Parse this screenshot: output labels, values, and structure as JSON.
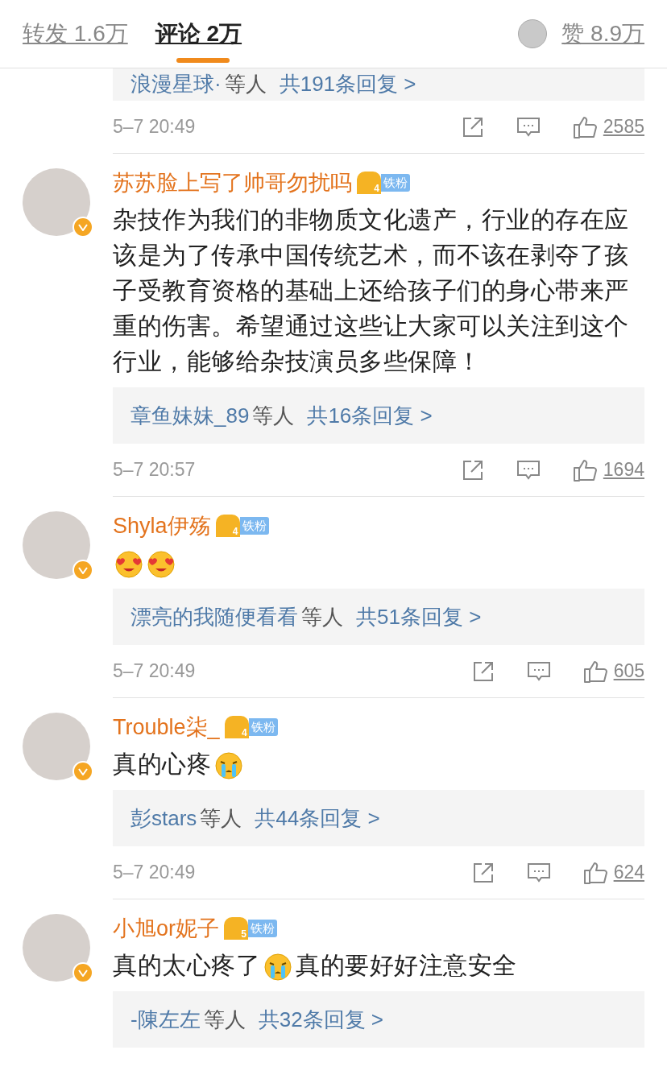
{
  "tabs": [
    {
      "label": "转发 1.6万",
      "selected": false
    },
    {
      "label": "评论 2万",
      "selected": true
    }
  ],
  "likes_tab": {
    "label": "赞 8.9万"
  },
  "partial_thread": {
    "replies": {
      "users": "浪漫星球·",
      "others": "等人",
      "count": "共191条回复 >"
    },
    "time": "5–7 20:49",
    "likes": "2585"
  },
  "comments": [
    {
      "name": "苏苏脸上写了帅哥勿扰吗",
      "verified": true,
      "badge_level": "4",
      "fan_label": "铁粉",
      "body": [
        {
          "kind": "text",
          "text": "杂技作为我们的非物质文化遗产，行业的存在应该是为了传承中国传统艺术，而不该在剥夺了孩子受教育资格的基础上还给孩子们的身心带来严重的伤害。希望通过这些让大家可以关注到这个行业，能够给杂技演员多些保障！"
        }
      ],
      "replies": {
        "users": "章鱼妹妹_89",
        "others": "等人",
        "count": "共16条回复 >"
      },
      "time": "5–7 20:57",
      "likes": "1694"
    },
    {
      "name": "Shyla伊殇",
      "verified": true,
      "badge_level": "4",
      "fan_label": "铁粉",
      "body": [
        {
          "kind": "love_emoji"
        },
        {
          "kind": "love_emoji"
        }
      ],
      "replies": {
        "users": "漂亮的我随便看看",
        "others": "等人",
        "count": "共51条回复 >"
      },
      "time": "5–7 20:49",
      "likes": "605"
    },
    {
      "name": "Trouble柒_",
      "verified": true,
      "badge_level": "4",
      "fan_label": "铁粉",
      "body": [
        {
          "kind": "text",
          "text": "真的心疼"
        },
        {
          "kind": "cry_emoji"
        }
      ],
      "replies": {
        "users": "彭stars",
        "others": "等人",
        "count": "共44条回复 >"
      },
      "time": "5–7 20:49",
      "likes": "624"
    },
    {
      "name": "小旭or妮子",
      "verified": true,
      "badge_level": "5",
      "fan_label": "铁粉",
      "body": [
        {
          "kind": "text",
          "text": "真的太心疼了"
        },
        {
          "kind": "cry_emoji"
        },
        {
          "kind": "text",
          "text": "真的要好好注意安全"
        }
      ],
      "replies": {
        "users": "-陳左左",
        "others": "等人",
        "count": "共32条回复 >"
      }
    }
  ]
}
